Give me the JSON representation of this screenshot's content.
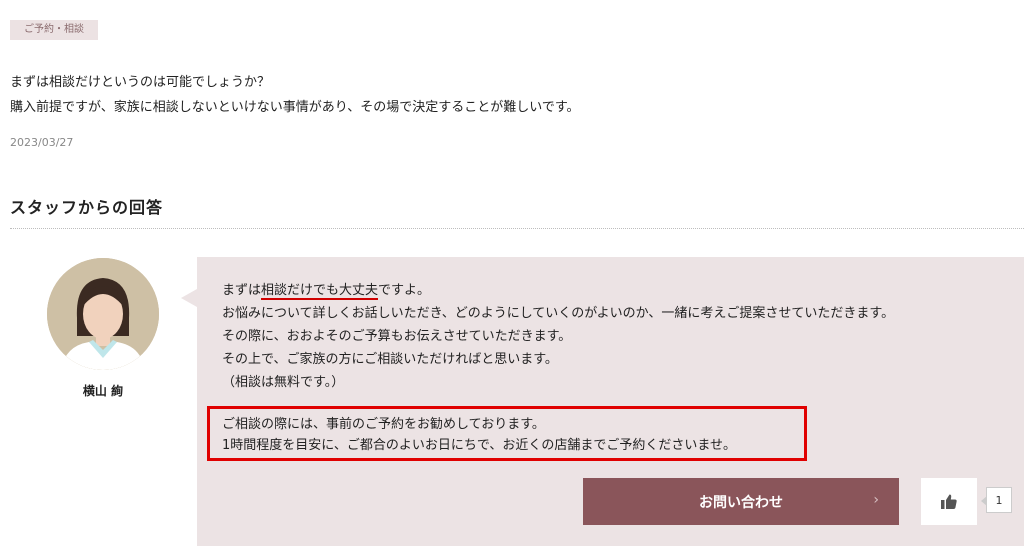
{
  "question": {
    "category": "ご予約・相談",
    "line1": "まずは相談だけというのは可能でしょうか？",
    "line2": "購入前提ですが、家族に相談しないといけない事情があり、その場で決定することが難しいです。",
    "date": "2023/03/27"
  },
  "answer": {
    "heading": "スタッフからの回答",
    "staff_name": "横山 絢",
    "reply": {
      "l1_pre": "まずは",
      "l1_underline": "相談だけでも大丈夫",
      "l1_post": "ですよ。",
      "l2": "お悩みについて詳しくお話しいただき、どのようにしていくのがよいのか、一緒に考えご提案させていただきます。",
      "l3": "その際に、おおよそのご予算もお伝えさせていただきます。",
      "l4": "その上で、ご家族の方にご相談いただければと思います。",
      "l5": "（相談は無料です。）"
    },
    "note": {
      "l1": "ご相談の際には、事前のご予約をお勧めしております。",
      "l2": "1時間程度を目安に、ご都合のよいお日にちで、お近くの店舗までご予約くださいませ。"
    }
  },
  "actions": {
    "contact_label": "お問い合わせ",
    "like_count": "1"
  },
  "colors": {
    "accent": "#8a555a",
    "bubble_bg": "#ece3e4",
    "highlight": "#e00000"
  },
  "icons": {
    "contact_chevron": "chevron-right-icon",
    "like": "thumbs-up-icon"
  }
}
